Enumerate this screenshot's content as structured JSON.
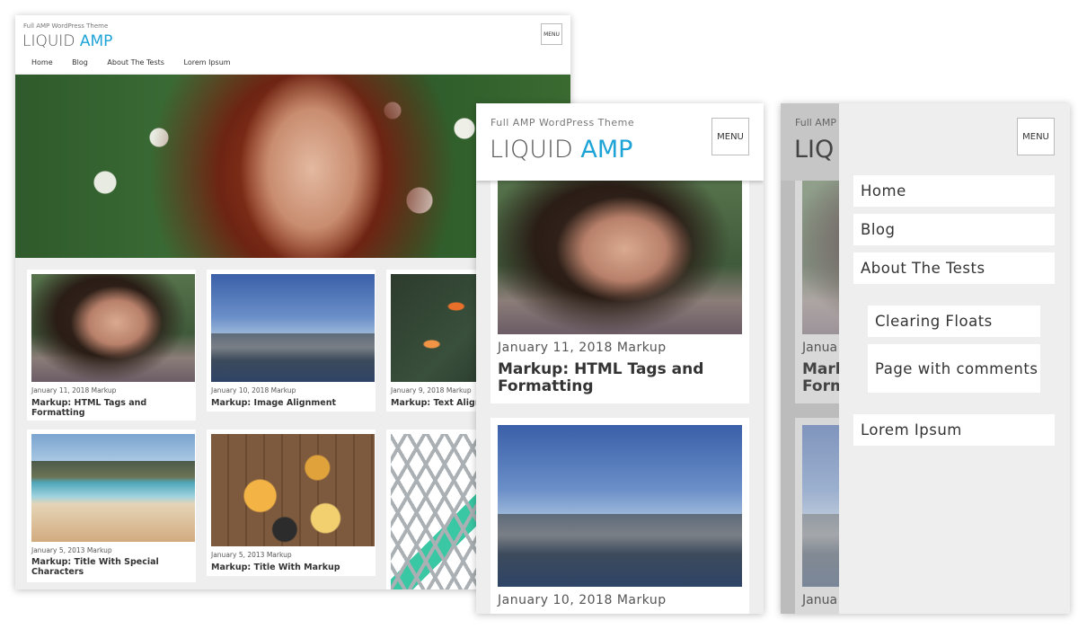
{
  "desktop": {
    "tagline": "Full AMP WordPress Theme",
    "logo_main": "LIQUID",
    "logo_accent": "AMP",
    "menu_label": "MENU",
    "nav": [
      "Home",
      "Blog",
      "About The Tests",
      "Lorem Ipsum"
    ],
    "cards": [
      {
        "meta": "January 11, 2018 Markup",
        "title": "Markup: HTML Tags and Formatting"
      },
      {
        "meta": "January 10, 2018 Markup",
        "title": "Markup: Image Alignment"
      },
      {
        "meta": "January 9, 2018 Markup",
        "title": "Markup: Text Alignment"
      },
      {
        "meta": "January 5, 2013 Markup",
        "title": "Markup: Title With Special Characters"
      },
      {
        "meta": "January 5, 2013 Markup",
        "title": "Markup: Title With Markup"
      }
    ]
  },
  "mobile": {
    "tagline": "Full AMP WordPress Theme",
    "logo_main": "LIQUID",
    "logo_accent": "AMP",
    "menu_label": "MENU",
    "cards": [
      {
        "meta": "January 11, 2018 Markup",
        "title": "Markup: HTML Tags and Formatting"
      },
      {
        "meta": "January 10, 2018 Markup",
        "title": ""
      }
    ]
  },
  "menu_open": {
    "ghost_tag": "Full AMP",
    "ghost_logo": "LIQ",
    "ghost_meta": "Janua",
    "ghost_title_1": "Mark",
    "ghost_title_2": "Form",
    "ghost_meta_2": "Janua",
    "menu_label": "MENU",
    "items": [
      "Home",
      "Blog",
      "About The Tests"
    ],
    "sub_items": [
      "Clearing Floats",
      "Page with comments"
    ],
    "last_item": "Lorem Ipsum"
  },
  "colors": {
    "accent": "#1ea3d6",
    "panel_bg": "#eeeeee"
  }
}
